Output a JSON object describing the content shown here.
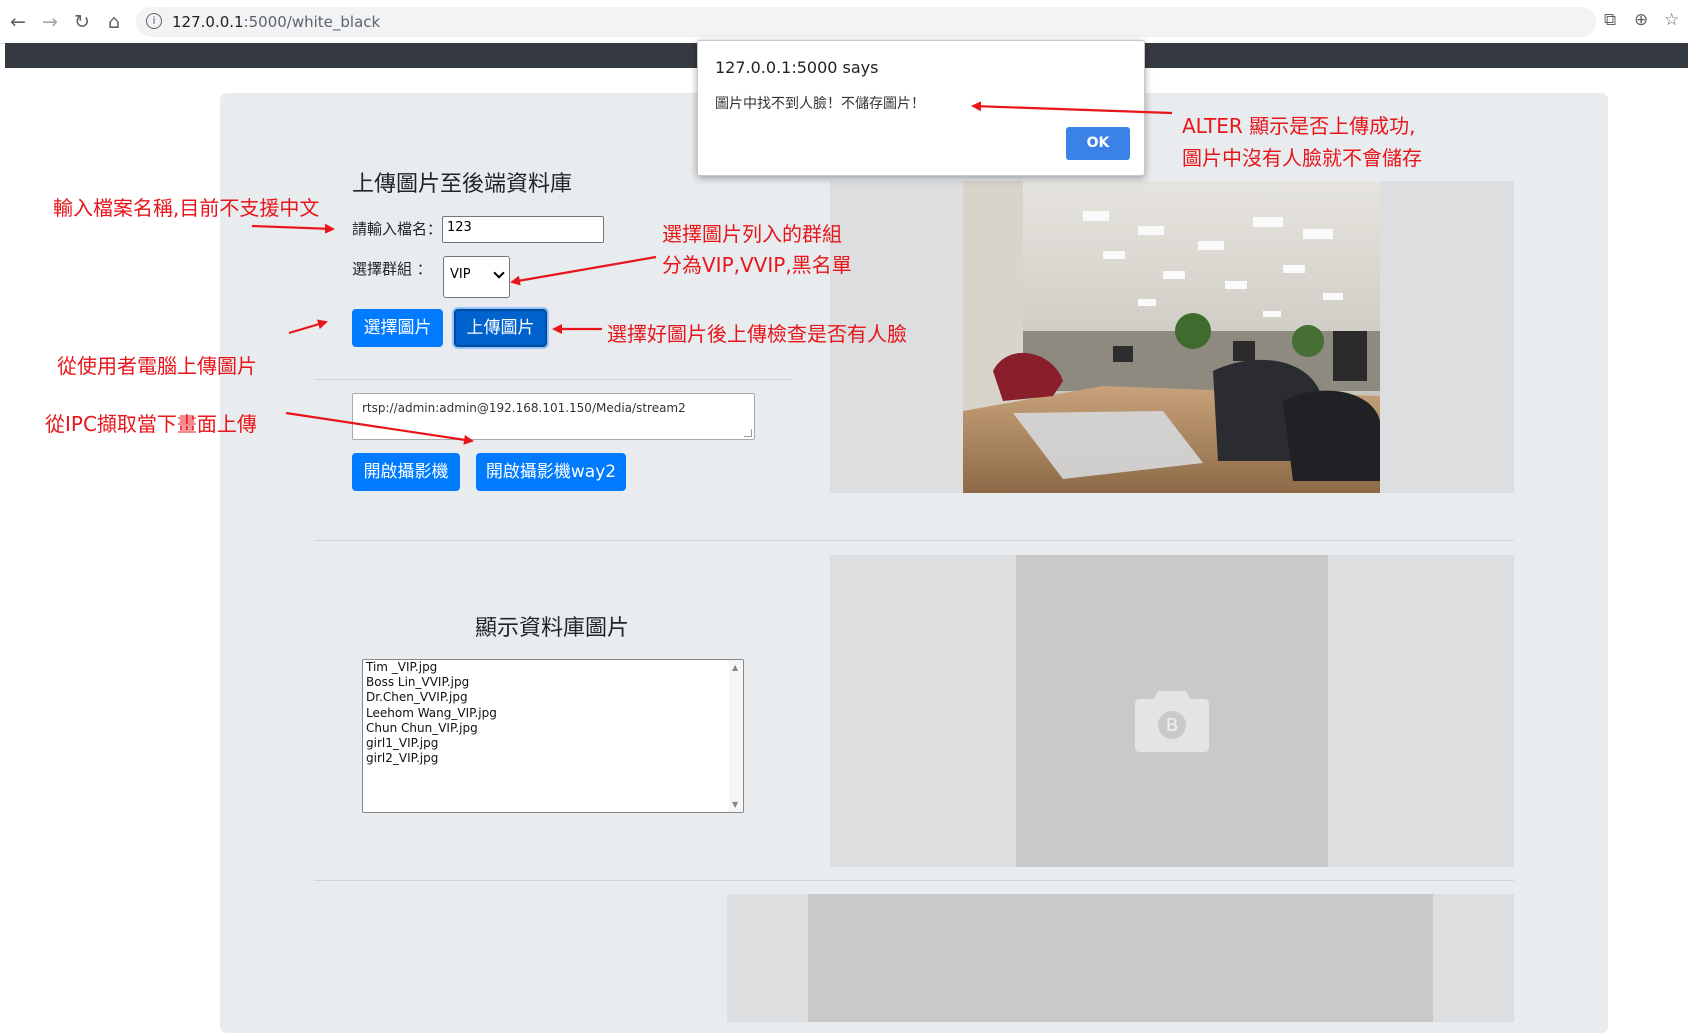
{
  "browser": {
    "url_host": "127.0.0.1",
    "url_path": ":5000/white_black"
  },
  "upload": {
    "heading": "上傳圖片至後端資料庫",
    "filename_label": "請輸入檔名：",
    "filename_value": "123",
    "group_label": "選擇群組 ：",
    "group_selected": "VIP",
    "choose_button": "選擇圖片",
    "upload_button": "上傳圖片"
  },
  "camera": {
    "rtsp_value": "rtsp://admin:admin@192.168.101.150/Media/stream2",
    "open_button": "開啟攝影機",
    "open_button_way2": "開啟攝影機way2"
  },
  "database": {
    "heading": "顯示資料庫圖片",
    "files": [
      "Tim _VIP.jpg",
      "Boss Lin_VVIP.jpg",
      "Dr.Chen_VVIP.jpg",
      "Leehom Wang_VIP.jpg",
      "Chun Chun_VIP.jpg",
      "girl1_VIP.jpg",
      "girl2_VIP.jpg"
    ],
    "placeholder_letter": "B"
  },
  "alert": {
    "title": "127.0.0.1:5000 says",
    "message": "圖片中找不到人臉！不儲存圖片！",
    "ok": "OK"
  },
  "annotations": {
    "filename_note": "輸入檔案名稱,目前不支援中文",
    "group_note_line1": "選擇圖片列入的群組",
    "group_note_line2": "分為VIP,VVIP,黑名單",
    "upload_note": "選擇好圖片後上傳檢查是否有人臉",
    "choose_note": "從使用者電腦上傳圖片",
    "ipc_note": "從IPC擷取當下畫面上傳",
    "alert_note_line1": "ALTER 顯示是否上傳成功,",
    "alert_note_line2": "圖片中沒有人臉就不會儲存"
  },
  "colors": {
    "primary": "#007bff",
    "annotation": "#e8151a",
    "card": "#e9ecef",
    "navbar": "#343a40"
  }
}
